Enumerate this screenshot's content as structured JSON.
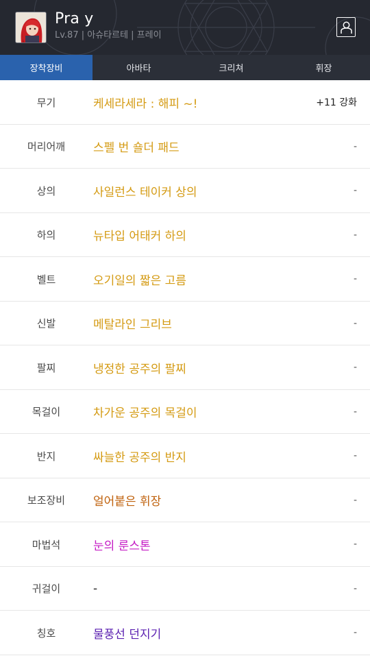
{
  "header": {
    "character_name": "Pra y",
    "subtitle": "Lv.87 | 아슈타르테 | 프레이",
    "avatar_icon": "character-portrait-icon",
    "profile_icon": "profile-card-icon"
  },
  "tabs": [
    {
      "label": "장착장비",
      "active": true
    },
    {
      "label": "아바타",
      "active": false
    },
    {
      "label": "크리쳐",
      "active": false
    },
    {
      "label": "휘장",
      "active": false
    }
  ],
  "equipment": [
    {
      "slot": "무기",
      "item": "케세라세라 : 해피 ~!",
      "enhance": "+11 강화",
      "color": "#d49a12"
    },
    {
      "slot": "머리어깨",
      "item": "스펠 번 숄더 패드",
      "enhance": "-",
      "color": "#d49a12"
    },
    {
      "slot": "상의",
      "item": "사일런스 테이커 상의",
      "enhance": "-",
      "color": "#d49a12"
    },
    {
      "slot": "하의",
      "item": "뉴타입 어태커 하의",
      "enhance": "-",
      "color": "#d49a12"
    },
    {
      "slot": "벨트",
      "item": "오기일의 짧은 고름",
      "enhance": "-",
      "color": "#d49a12"
    },
    {
      "slot": "신발",
      "item": "메탈라인 그리브",
      "enhance": "-",
      "color": "#d49a12"
    },
    {
      "slot": "팔찌",
      "item": "냉정한 공주의 팔찌",
      "enhance": "-",
      "color": "#d49a12"
    },
    {
      "slot": "목걸이",
      "item": "차가운 공주의 목걸이",
      "enhance": "-",
      "color": "#d49a12"
    },
    {
      "slot": "반지",
      "item": "싸늘한 공주의 반지",
      "enhance": "-",
      "color": "#d49a12"
    },
    {
      "slot": "보조장비",
      "item": "얼어붙은 휘장",
      "enhance": "-",
      "color": "#c0620e"
    },
    {
      "slot": "마법석",
      "item": "눈의 룬스톤",
      "enhance": "-",
      "color": "#c41ac4"
    },
    {
      "slot": "귀걸이",
      "item": "-",
      "enhance": "-",
      "color": "#222222"
    },
    {
      "slot": "칭호",
      "item": "물풍선 던지기",
      "enhance": "-",
      "color": "#5a1fb0"
    }
  ]
}
